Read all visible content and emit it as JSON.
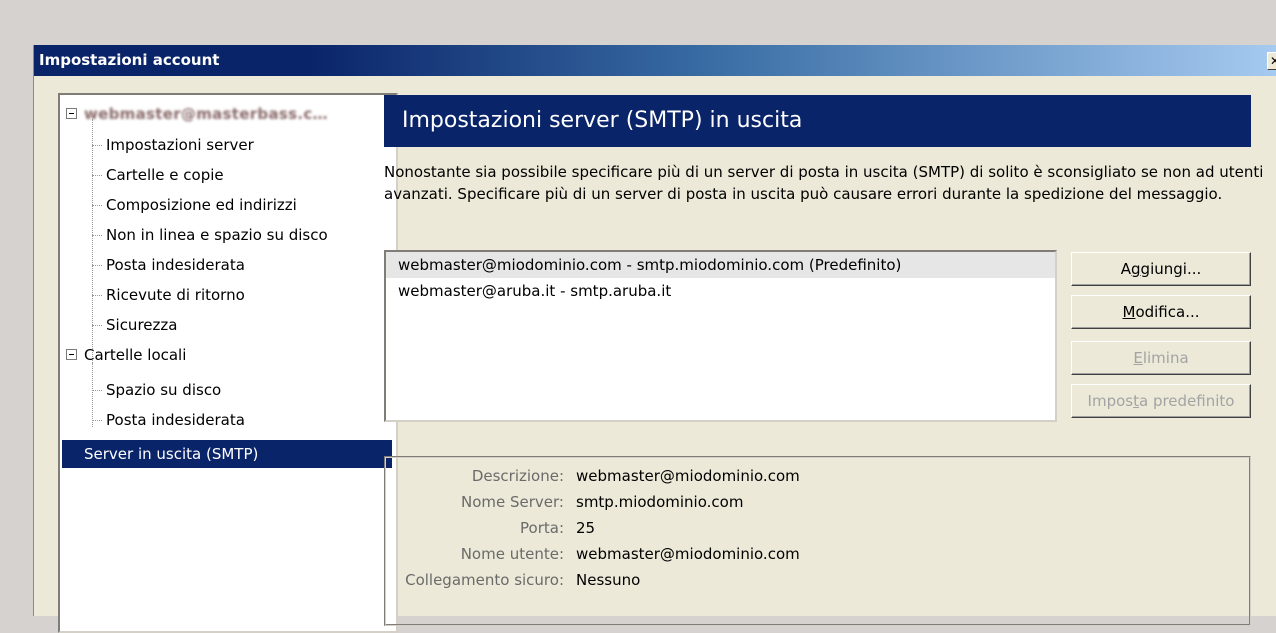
{
  "dialog": {
    "title": "Impostazioni account",
    "close_glyph": "✕"
  },
  "tree": {
    "account_name": "webmaster@masterbass.c…",
    "account_children": [
      "Impostazioni server",
      "Cartelle e copie",
      "Composizione ed indirizzi",
      "Non in linea e spazio su disco",
      "Posta indesiderata",
      "Ricevute di ritorno",
      "Sicurezza"
    ],
    "local_folders": "Cartelle locali",
    "local_children": [
      "Spazio su disco",
      "Posta indesiderata"
    ],
    "smtp": "Server in uscita (SMTP)"
  },
  "panel": {
    "header": "Impostazioni server (SMTP) in uscita",
    "description": "Nonostante sia possibile specificare più di un server di posta in uscita (SMTP) di solito è sconsigliato se non ad utenti avanzati. Specificare più di un server di posta in uscita può causare errori durante la spedizione del messaggio.",
    "servers": [
      "webmaster@miodominio.com - smtp.miodominio.com (Predefinito)",
      "webmaster@aruba.it - smtp.aruba.it"
    ],
    "buttons": {
      "add_pre": "A",
      "add_key": "g",
      "add_post": "giungi...",
      "edit_pre": "",
      "edit_key": "M",
      "edit_post": "odifica...",
      "delete_pre": "",
      "delete_key": "E",
      "delete_post": "limina",
      "default_pre": "Impos",
      "default_key": "t",
      "default_post": "a predefinito"
    },
    "details": {
      "description_label": "Descrizione:",
      "description_value": "webmaster@miodominio.com",
      "server_label": "Nome Server:",
      "server_value": "smtp.miodominio.com",
      "port_label": "Porta:",
      "port_value": "25",
      "user_label": "Nome utente:",
      "user_value": "webmaster@miodominio.com",
      "secure_label": "Collegamento sicuro:",
      "secure_value": "Nessuno"
    }
  }
}
